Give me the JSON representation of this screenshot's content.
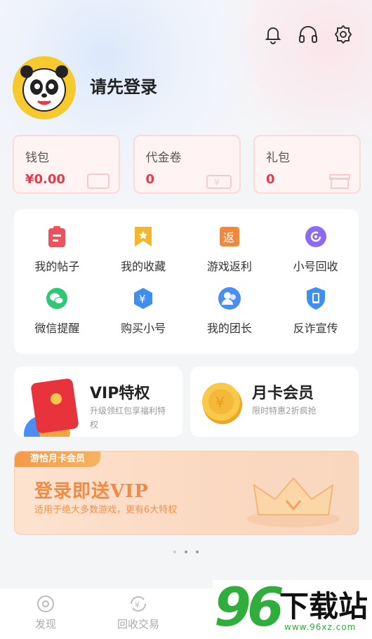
{
  "header": {
    "login_text": "请先登录",
    "icons": [
      "bell-icon",
      "headset-icon",
      "settings-gear-icon"
    ]
  },
  "wallet": [
    {
      "label": "钱包",
      "value": "¥0.00"
    },
    {
      "label": "代金卷",
      "value": "0"
    },
    {
      "label": "礼包",
      "value": "0"
    }
  ],
  "menu": [
    {
      "label": "我的帖子",
      "icon": "post-icon",
      "color": "#f0505c"
    },
    {
      "label": "我的收藏",
      "icon": "bookmark-star-icon",
      "color": "#f5b52c"
    },
    {
      "label": "游戏返利",
      "icon": "rebate-icon",
      "color": "#f2883c"
    },
    {
      "label": "小号回收",
      "icon": "recycle-icon",
      "color": "#8b6cf0"
    },
    {
      "label": "微信提醒",
      "icon": "wechat-icon",
      "color": "#2dc874"
    },
    {
      "label": "购买小号",
      "icon": "yen-shield-icon",
      "color": "#3f8ef2"
    },
    {
      "label": "我的团长",
      "icon": "team-leader-icon",
      "color": "#4a8ef4"
    },
    {
      "label": "反诈宣传",
      "icon": "phone-shield-icon",
      "color": "#3f8ef2"
    }
  ],
  "promos": {
    "vip": {
      "title": "VIP特权",
      "subtitle": "升级领红包享福利特权"
    },
    "monthly": {
      "title": "月卡会员",
      "subtitle": "限时特惠2折疯抢"
    }
  },
  "banner": {
    "tag": "游恰月卡会员",
    "headline": "登录即送VIP",
    "desc": "适用于绝大多数游戏，更有6大特权"
  },
  "tabs": [
    {
      "label": "发现",
      "icon": "discover-icon"
    },
    {
      "label": "回收交易",
      "icon": "recycle-trade-icon"
    }
  ],
  "watermark": {
    "number": "96",
    "text": "下载站",
    "url": "www.96xz.com"
  },
  "colors": {
    "accent_red": "#e8394a",
    "banner_orange": "#f08a45",
    "watermark_green": "#2fae3b"
  }
}
